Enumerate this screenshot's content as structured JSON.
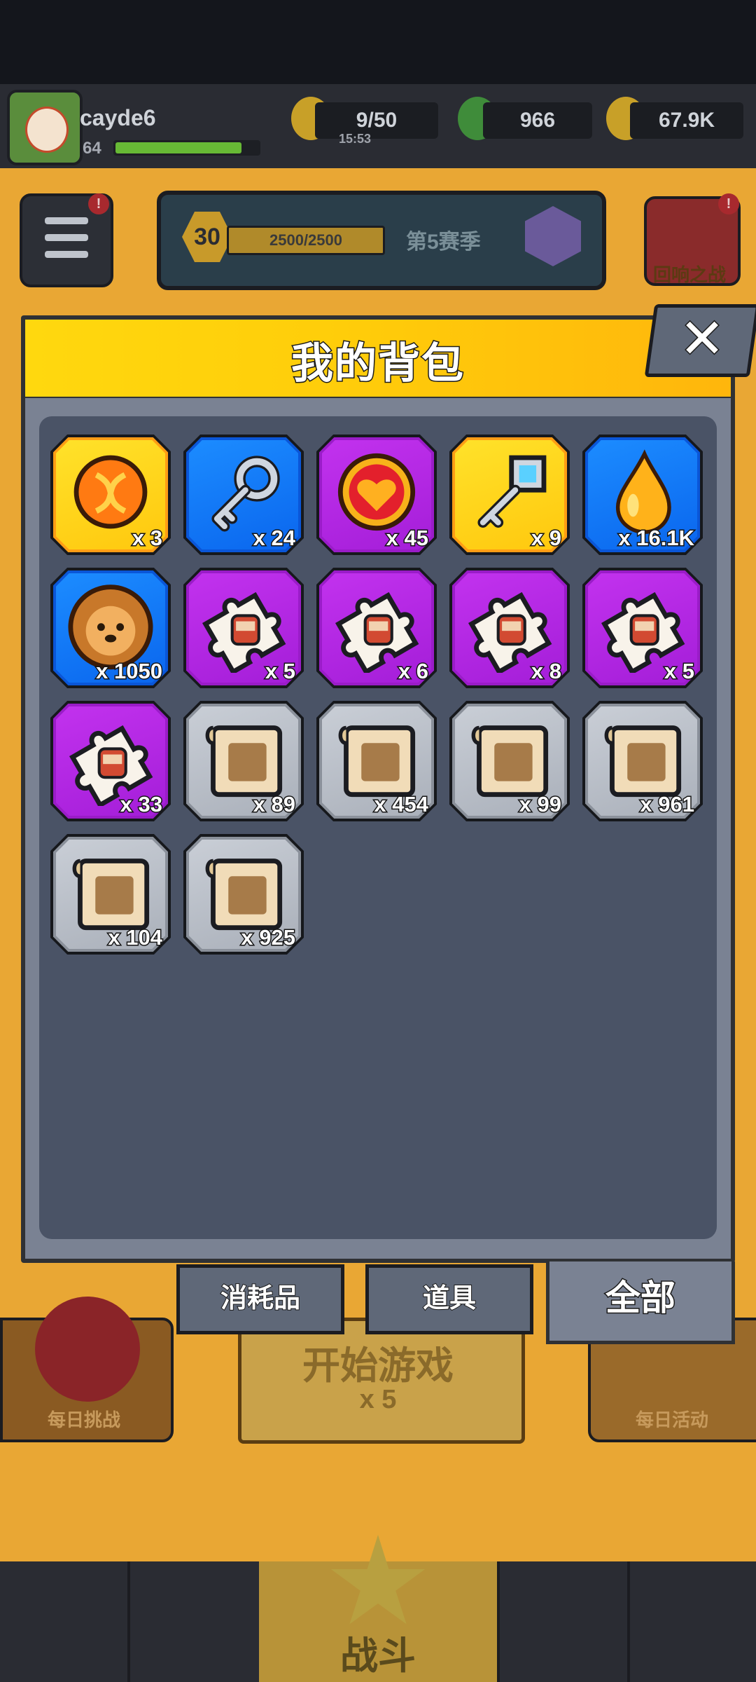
{
  "player": {
    "name": "cayde6",
    "level": "64"
  },
  "resources": {
    "energy": "9/50",
    "energy_timer": "15:53",
    "gems": "966",
    "gold": "67.9K"
  },
  "season": {
    "level": "30",
    "progress": "2500/2500",
    "name": "第5赛季"
  },
  "echo_battle_label": "回响之战",
  "daily_challenge_label": "每日挑战",
  "daily_activity_label": "每日活动",
  "start_game": {
    "label": "开始游戏",
    "cost": "x 5"
  },
  "battle_label": "战斗",
  "notifications": {
    "menu": "!",
    "echo": "!",
    "shop": "!",
    "weapon": "↑",
    "talent": "!"
  },
  "modal": {
    "title": "我的背包",
    "close_label": "✕",
    "items": [
      {
        "name": "dna-orb",
        "rarity": "gold",
        "qty": "x 3"
      },
      {
        "name": "silver-key",
        "rarity": "blue",
        "qty": "x 24"
      },
      {
        "name": "heart-orb",
        "rarity": "purple",
        "qty": "x 45"
      },
      {
        "name": "crystal-key",
        "rarity": "gold",
        "qty": "x 9"
      },
      {
        "name": "golden-drop",
        "rarity": "blue",
        "qty": "x 16.1K"
      },
      {
        "name": "pet-cookie",
        "rarity": "blue",
        "qty": "x 1050"
      },
      {
        "name": "puzzle-piece-1",
        "rarity": "purple",
        "qty": "x 5"
      },
      {
        "name": "puzzle-piece-2",
        "rarity": "purple",
        "qty": "x 6"
      },
      {
        "name": "puzzle-piece-3",
        "rarity": "purple",
        "qty": "x 8"
      },
      {
        "name": "puzzle-piece-4",
        "rarity": "purple",
        "qty": "x 5"
      },
      {
        "name": "puzzle-piece-5",
        "rarity": "purple",
        "qty": "x 33"
      },
      {
        "name": "weapon-scroll",
        "rarity": "gray",
        "qty": "x 89"
      },
      {
        "name": "armor-scroll",
        "rarity": "gray",
        "qty": "x 454"
      },
      {
        "name": "necklace-scroll",
        "rarity": "gray",
        "qty": "x 99"
      },
      {
        "name": "belt-scroll",
        "rarity": "gray",
        "qty": "x 961"
      },
      {
        "name": "glove-scroll",
        "rarity": "gray",
        "qty": "x 104"
      },
      {
        "name": "boots-scroll",
        "rarity": "gray",
        "qty": "x 925"
      }
    ],
    "tabs": [
      {
        "label": "消耗品",
        "active": false
      },
      {
        "label": "道具",
        "active": false
      },
      {
        "label": "全部",
        "active": true
      }
    ]
  },
  "colors": {
    "gold": "#ffd21a",
    "blue": "#0d6ff0",
    "purple": "#b126e0",
    "gray": "#b3b9c2",
    "header_yellow": "#ffcd0a",
    "panel": "#4a5366"
  }
}
